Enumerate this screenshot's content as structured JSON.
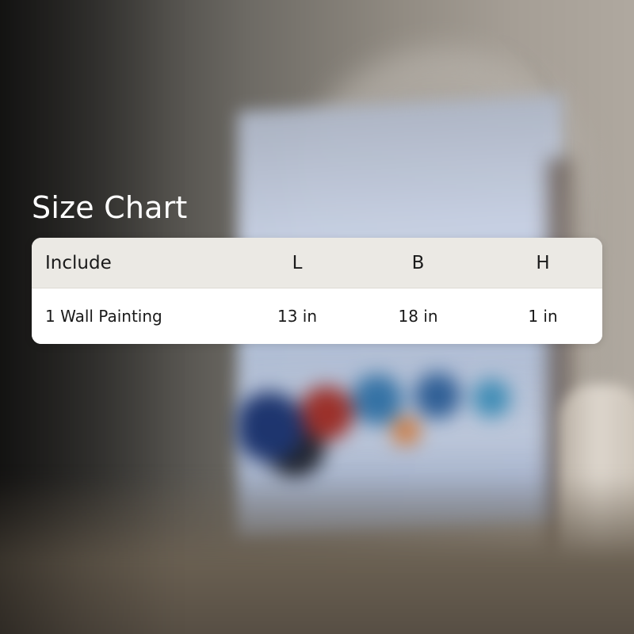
{
  "title": "Size Chart",
  "table": {
    "headers": [
      "Include",
      "L",
      "B",
      "H"
    ],
    "rows": [
      [
        "1 Wall Painting",
        "13 in",
        "18 in",
        "1 in"
      ]
    ]
  },
  "colors": {
    "title_text": "#ffffff",
    "header_background": "#ebe9e4",
    "body_background": "#ffffff",
    "cell_text": "#1a1a1a"
  }
}
